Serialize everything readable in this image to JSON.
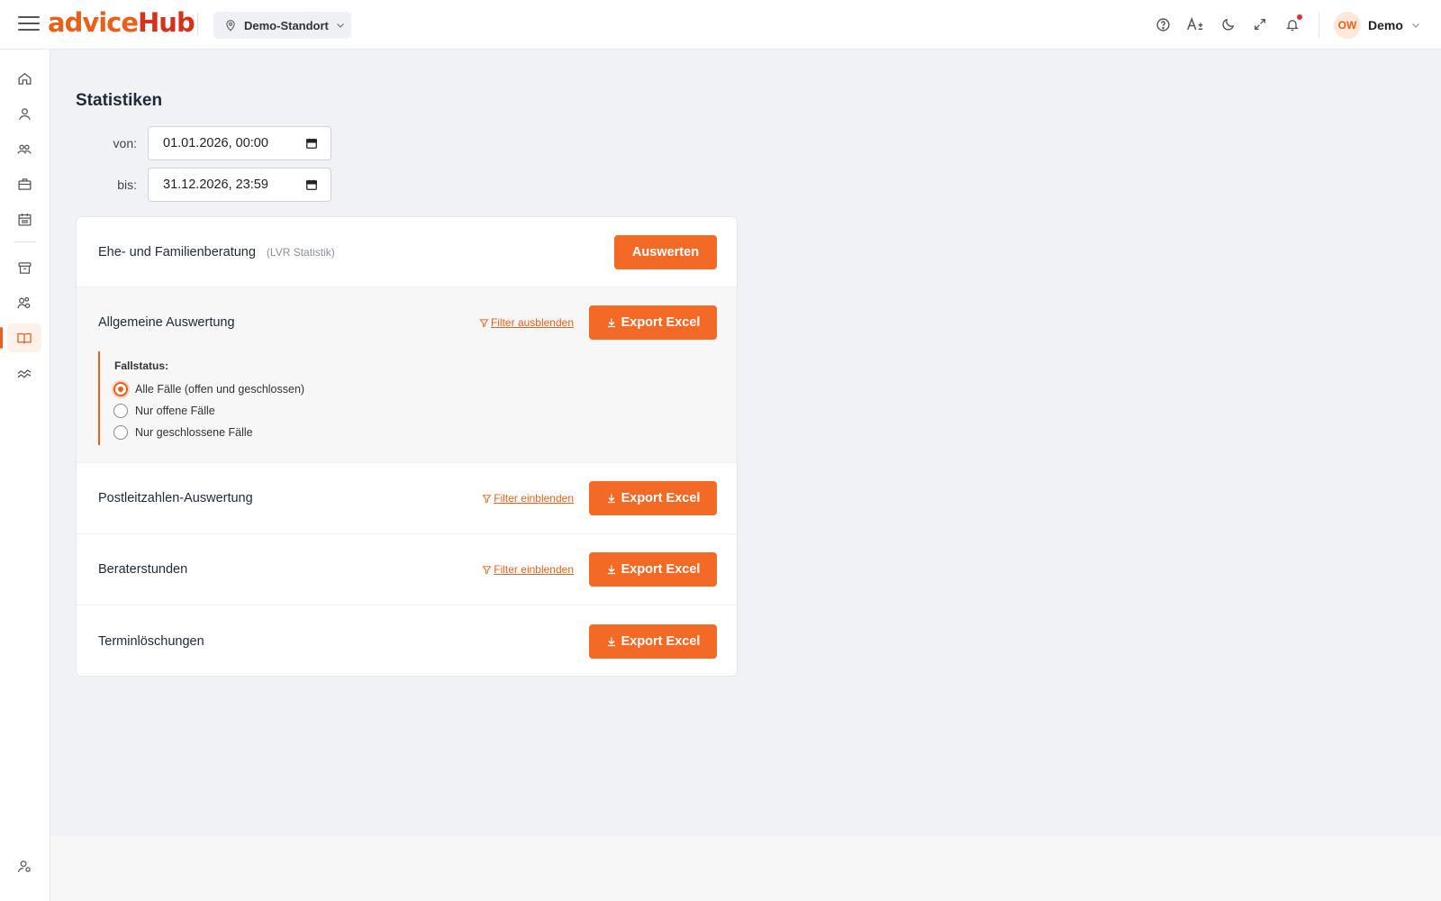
{
  "brand": {
    "logo_part1": "advice",
    "logo_part2": "Hub"
  },
  "header": {
    "location": "Demo-Standort",
    "icons": [
      "help-icon",
      "font-size-icon",
      "dark-mode-icon",
      "fullscreen-icon",
      "notification-icon"
    ],
    "user_initials": "OW",
    "user_name": "Demo"
  },
  "sidebar": {
    "items": [
      "home-icon",
      "user-icon",
      "group-icon",
      "briefcase-icon",
      "calendar-icon",
      "archive-icon",
      "users-settings-icon",
      "book-icon",
      "chart-icon"
    ],
    "active": "book-icon",
    "bottom": "user-settings-icon"
  },
  "page": {
    "title": "Statistiken",
    "from_label": "von:",
    "from_value": "01.01.2026, 00:00",
    "to_label": "bis:",
    "to_value": "31.12.2026, 23:59"
  },
  "sections": {
    "lvr": {
      "title": "Ehe- und Familienberatung",
      "sub": "(LVR Statistik)",
      "button": "Auswerten"
    },
    "allgemein": {
      "title": "Allgemeine Auswertung",
      "filter": "Filter ausblenden",
      "button": "Export Excel"
    },
    "plz": {
      "title": "Postleitzahlen-Auswertung",
      "filter": "Filter einblenden",
      "button": "Export Excel"
    },
    "berater": {
      "title": "Beraterstunden",
      "filter": "Filter einblenden",
      "button": "Export Excel"
    },
    "termin": {
      "title": "Terminlöschungen",
      "button": "Export Excel"
    }
  },
  "fallstatus": {
    "label": "Fallstatus:",
    "options": [
      "Alle Fälle (offen und geschlossen)",
      "Nur offene Fälle",
      "Nur geschlossene Fälle"
    ],
    "selected": "Alle Fälle (offen und geschlossen)"
  },
  "colors": {
    "accent": "#f26a26",
    "brand_red": "#d4321c"
  }
}
